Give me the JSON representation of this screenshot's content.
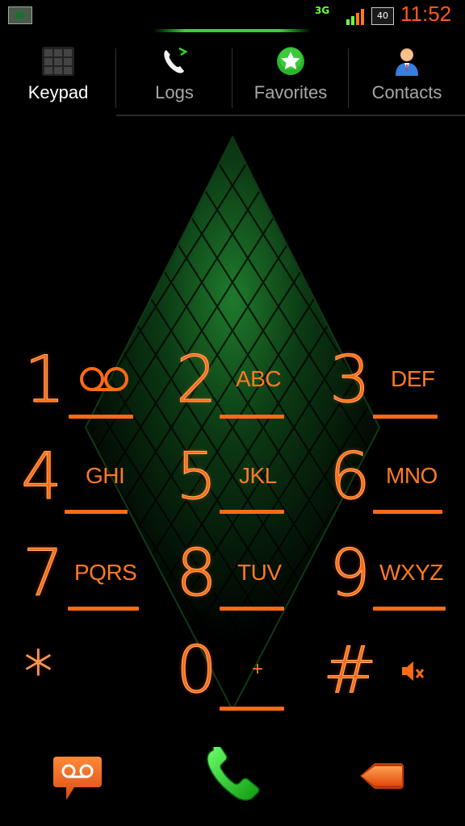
{
  "status_bar": {
    "network": "3G",
    "battery": "40",
    "time": "11:52"
  },
  "tabs": [
    {
      "label": "Keypad",
      "icon": "keypad-icon",
      "active": true
    },
    {
      "label": "Logs",
      "icon": "phone-logs-icon",
      "active": false
    },
    {
      "label": "Favorites",
      "icon": "star-icon",
      "active": false
    },
    {
      "label": "Contacts",
      "icon": "person-icon",
      "active": false
    }
  ],
  "keypad": [
    {
      "digit": "1",
      "letters": "",
      "sub_icon": "voicemail-icon"
    },
    {
      "digit": "2",
      "letters": "ABC"
    },
    {
      "digit": "3",
      "letters": "DEF"
    },
    {
      "digit": "4",
      "letters": "GHI"
    },
    {
      "digit": "5",
      "letters": "JKL"
    },
    {
      "digit": "6",
      "letters": "MNO"
    },
    {
      "digit": "7",
      "letters": "PQRS"
    },
    {
      "digit": "8",
      "letters": "TUV"
    },
    {
      "digit": "9",
      "letters": "WXYZ"
    },
    {
      "digit": "*",
      "letters": ""
    },
    {
      "digit": "0",
      "letters": "+"
    },
    {
      "digit": "#",
      "letters": "",
      "sub_icon": "mute-icon"
    }
  ],
  "bottom_actions": [
    {
      "name": "voicemail-button",
      "icon": "voicemail-icon"
    },
    {
      "name": "call-button",
      "icon": "phone-icon"
    },
    {
      "name": "delete-button",
      "icon": "backspace-arrow-icon"
    }
  ],
  "colors": {
    "accent": "#ff6a14",
    "time": "#ff5a1a",
    "call_green": "#2bd92b",
    "glow_green": "#1c6e2a"
  }
}
